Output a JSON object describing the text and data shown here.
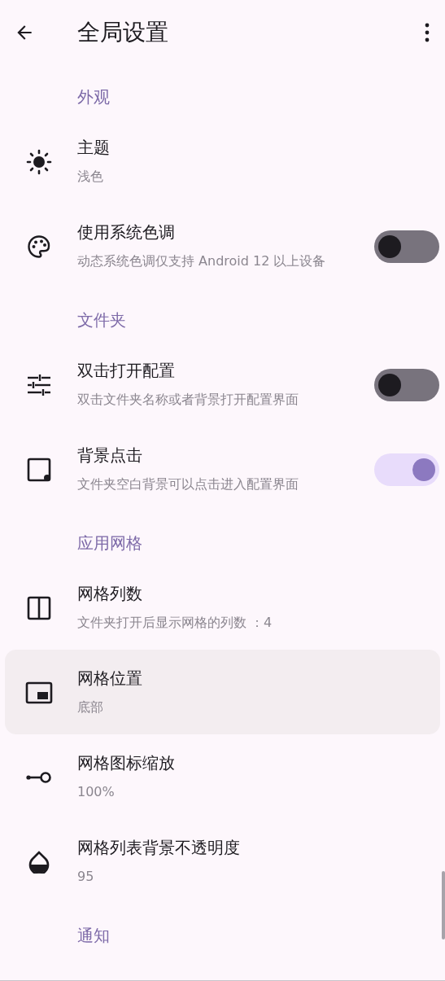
{
  "app_bar": {
    "title": "全局设置"
  },
  "sections": [
    {
      "header": "外观",
      "items": [
        {
          "kind": "sun",
          "title": "主题",
          "subtitle": "浅色",
          "highlighted": false
        },
        {
          "kind": "palette",
          "title": "使用系统色调",
          "subtitle": "动态系统色调仅支持 Android 12 以上设备",
          "highlighted": false,
          "switch": {
            "on": false
          }
        }
      ]
    },
    {
      "header": "文件夹",
      "items": [
        {
          "kind": "tune",
          "title": "双击打开配置",
          "subtitle": "双击文件夹名称或者背景打开配置界面",
          "highlighted": false,
          "switch": {
            "on": false
          }
        },
        {
          "kind": "square-dot",
          "title": "背景点击",
          "subtitle": "文件夹空白背景可以点击进入配置界面",
          "highlighted": false,
          "switch": {
            "on": true
          }
        }
      ]
    },
    {
      "header": "应用网格",
      "items": [
        {
          "kind": "columns",
          "title": "网格列数",
          "subtitle": "文件夹打开后显示网格的列数 ：4",
          "highlighted": false
        },
        {
          "kind": "pip",
          "title": "网格位置",
          "subtitle": "底部",
          "highlighted": true
        },
        {
          "kind": "scale",
          "title": "网格图标缩放",
          "subtitle": "100%",
          "highlighted": false
        },
        {
          "kind": "drop",
          "title": "网格列表背景不透明度",
          "subtitle": "95",
          "highlighted": false
        }
      ]
    },
    {
      "header": "通知"
    }
  ]
}
